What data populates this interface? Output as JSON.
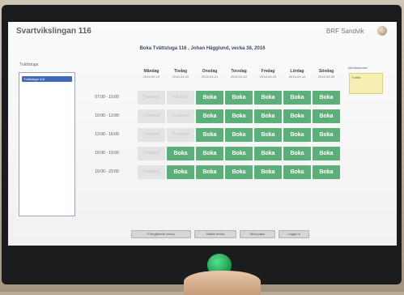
{
  "app": {
    "title": "Svartvikslingan 116",
    "brand": "BRF Sandvik"
  },
  "booking_header": "Boka  Tvättstuga 116 , Johan Hägglund, vecka 38, 2016",
  "left_panel": {
    "label": "Tvättstuga",
    "selected_item": "Tvättstuga 116"
  },
  "right_panel": {
    "label": "Meddelanden",
    "note": "Tvätta"
  },
  "days": [
    {
      "name": "Måndag",
      "date": "2016-09-19"
    },
    {
      "name": "Tisdag",
      "date": "2016-09-20"
    },
    {
      "name": "Onsdag",
      "date": "2016-09-21"
    },
    {
      "name": "Torsdag",
      "date": "2016-09-22"
    },
    {
      "name": "Fredag",
      "date": "2016-09-23"
    },
    {
      "name": "Lördag",
      "date": "2016-09-24"
    },
    {
      "name": "Söndag",
      "date": "2016-09-25"
    }
  ],
  "time_slots": [
    "07:00 - 10:00",
    "10:00 - 13:00",
    "13:00 - 16:00",
    "16:00 - 19:00",
    "19:00 - 22:00"
  ],
  "book_label": "Boka",
  "passed_label": "Passerat",
  "availability": [
    [
      "passed",
      "passed",
      "book",
      "book",
      "book",
      "book",
      "book"
    ],
    [
      "passed",
      "passed",
      "book",
      "book",
      "book",
      "book",
      "book"
    ],
    [
      "passed",
      "passed",
      "book",
      "book",
      "book",
      "book",
      "book"
    ],
    [
      "passed",
      "book",
      "book",
      "book",
      "book",
      "book",
      "book"
    ],
    [
      "passed",
      "book",
      "book",
      "book",
      "book",
      "book",
      "book"
    ]
  ],
  "bottom_buttons": [
    "Föregående vecka",
    "Nästa vecka",
    "Mina pass",
    "Logga ut"
  ],
  "colors": {
    "available": "#5bb07a",
    "passed": "#e3e3e3",
    "selected": "#3f69b8",
    "reader": "#1ec45f"
  },
  "icons": {
    "brand_logo": "logo-icon",
    "reader": "nfc-reader-icon"
  }
}
